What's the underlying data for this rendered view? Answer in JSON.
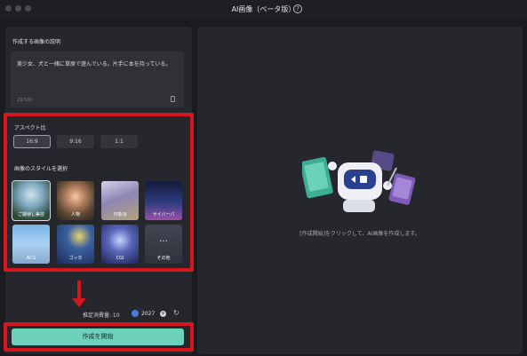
{
  "window": {
    "title": "AI画像（ベータ版）"
  },
  "prompt": {
    "label": "作成する画像の説明",
    "text": "美少女、犬と一緒に草原で遊んでいる。片手に本を持っている。",
    "char_count": "29/500"
  },
  "aspect": {
    "label": "アスペクト比",
    "options": [
      "16:9",
      "9:16",
      "1:1"
    ],
    "selected": "16:9"
  },
  "style": {
    "label": "画像のスタイルを選択",
    "tiles": [
      {
        "name": "ご期待し美芸"
      },
      {
        "name": "人物"
      },
      {
        "name": "印象派"
      },
      {
        "name": "サイバーパ"
      },
      {
        "name": "ACG"
      },
      {
        "name": "ゴッホ"
      },
      {
        "name": "CGI"
      },
      {
        "name": "その他"
      }
    ]
  },
  "footer": {
    "cost_label": "推定消費量: 10",
    "coin_value": "2027",
    "generate_label": "作成を開始"
  },
  "right": {
    "hint": "[作成開始]をクリックして、AI画像を作成します。"
  },
  "colors": {
    "accent": "#6bd1bb",
    "highlight": "#d6161c",
    "panel": "#26272c",
    "background": "#1a1b1f"
  }
}
